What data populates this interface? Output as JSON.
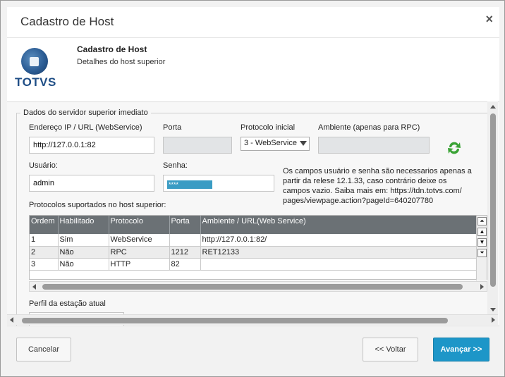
{
  "window": {
    "title": "Cadastro de Host",
    "close_label": "×"
  },
  "header": {
    "logo_text": "TOTVS",
    "title": "Cadastro de Host",
    "subtitle": "Detalhes do host superior"
  },
  "form": {
    "legend": "Dados do servidor superior imediato",
    "address_label": "Endereço IP / URL (WebService)",
    "address_value": "http://127.0.0.1:82",
    "port_label": "Porta",
    "port_value": "",
    "protocol_label": "Protocolo inicial",
    "protocol_value": "3 - WebService",
    "environment_label": "Ambiente (apenas para RPC)",
    "environment_value": "",
    "user_label": "Usuário:",
    "user_value": "admin",
    "password_label": "Senha:",
    "password_value": "****",
    "info_text": "Os campos usuário e senha são necessarios apenas a partir da relese 12.1.33, caso contrário deixe os campos vazio. Saiba mais em: https://tdn.totvs.com/ pages/viewpage.action?pageId=640207780",
    "protocols_label": "Protocolos suportados no host superior:",
    "profile_label": "Perfil da estação atual"
  },
  "protocols_table": {
    "headers": [
      "Ordem",
      "Habilitado",
      "Protocolo",
      "Porta",
      "Ambiente / URL(Web Service)"
    ],
    "rows": [
      [
        "1",
        "Sim",
        "WebService",
        "",
        "http://127.0.0.1:82/"
      ],
      [
        "2",
        "Não",
        "RPC",
        "1212",
        "RET12133"
      ],
      [
        "3",
        "Não",
        "HTTP",
        "82",
        ""
      ]
    ]
  },
  "footer": {
    "cancel_label": "Cancelar",
    "back_label": "<< Voltar",
    "next_label": "Avançar >>"
  },
  "colors": {
    "primary_button": "#1d96c8",
    "table_header": "#6b7175",
    "logo": "#1f4e86",
    "refresh_icon": "#3aa335"
  }
}
